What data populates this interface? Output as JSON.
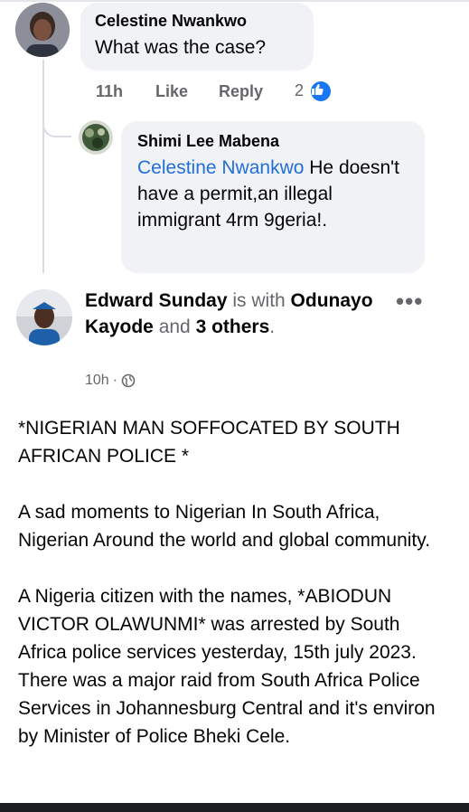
{
  "comments": [
    {
      "author": "Celestine Nwankwo",
      "text": "What was the case?",
      "time": "11h",
      "like_label": "Like",
      "reply_label": "Reply",
      "reaction_count": "2"
    }
  ],
  "reply": {
    "author": "Shimi Lee Mabena",
    "mention": "Celestine Nwankwo",
    "text_first": " He",
    "text_rest": "doesn't have a permit,an illegal immigrant 4rm 9geria!."
  },
  "post": {
    "author": "Edward Sunday",
    "with_text": " is with ",
    "tagged": "Odunayo Kayode",
    "and_text": " and ",
    "others": "3 others",
    "period": ".",
    "time": "10h",
    "dot": "·",
    "paragraphs": [
      "*NIGERIAN MAN SOFFOCATED BY SOUTH AFRICAN POLICE *",
      "A sad moments to Nigerian In South Africa, Nigerian Around  the world and global  community.",
      "A Nigeria citizen  with the names, *ABIODUN VICTOR OLAWUNMI* was arrested  by South Africa police services yesterday, 15th july 2023. There was a major raid from South Africa Police Services in Johannesburg Central and it's environ by Minister of Police Bheki Cele."
    ]
  },
  "icons": {
    "like_reaction": "like-reaction-icon",
    "globe": "globe-icon",
    "more": "more-options-icon"
  },
  "colors": {
    "link": "#216fdb",
    "bubble": "#f0f2f5",
    "secondary_text": "#65676b",
    "like_blue": "#1877f2"
  }
}
